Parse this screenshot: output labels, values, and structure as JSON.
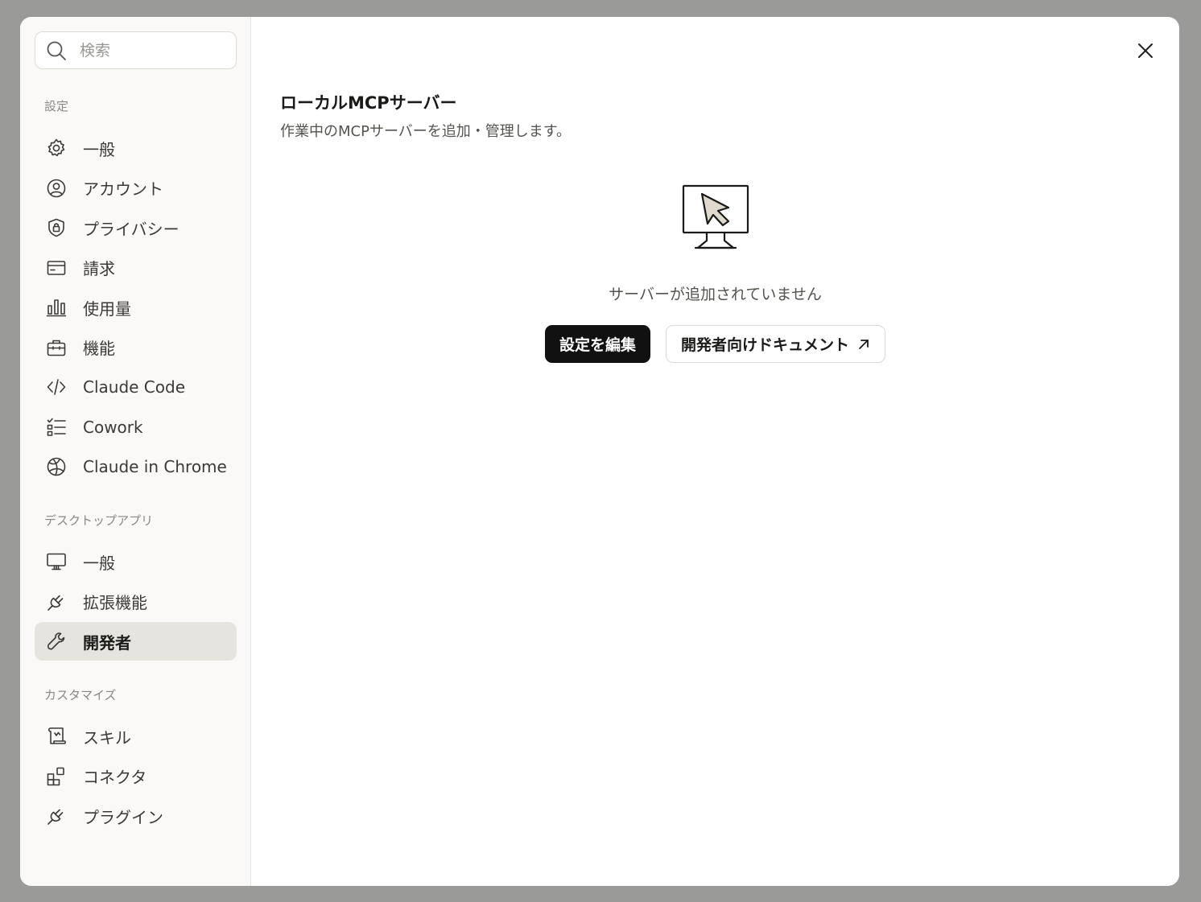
{
  "search": {
    "placeholder": "検索"
  },
  "sidebar": {
    "sections": [
      {
        "label": "設定",
        "items": [
          {
            "label": "一般",
            "icon": "gear-icon"
          },
          {
            "label": "アカウント",
            "icon": "user-circle-icon"
          },
          {
            "label": "プライバシー",
            "icon": "shield-lock-icon"
          },
          {
            "label": "請求",
            "icon": "credit-card-icon"
          },
          {
            "label": "使用量",
            "icon": "bar-chart-icon"
          },
          {
            "label": "機能",
            "icon": "briefcase-icon"
          },
          {
            "label": "Claude Code",
            "icon": "code-icon"
          },
          {
            "label": "Cowork",
            "icon": "checklist-icon"
          },
          {
            "label": "Claude in Chrome",
            "icon": "globe-icon"
          }
        ]
      },
      {
        "label": "デスクトップアプリ",
        "items": [
          {
            "label": "一般",
            "icon": "monitor-icon"
          },
          {
            "label": "拡張機能",
            "icon": "plug-icon"
          },
          {
            "label": "開発者",
            "icon": "wrench-icon",
            "active": true
          }
        ]
      },
      {
        "label": "カスタマイズ",
        "items": [
          {
            "label": "スキル",
            "icon": "scroll-icon"
          },
          {
            "label": "コネクタ",
            "icon": "blocks-icon"
          },
          {
            "label": "プラグイン",
            "icon": "plug-icon"
          }
        ]
      }
    ]
  },
  "main": {
    "title": "ローカルMCPサーバー",
    "subtitle": "作業中のMCPサーバーを追加・管理します。",
    "empty_text": "サーバーが追加されていません",
    "edit_button": "設定を編集",
    "docs_button": "開発者向けドキュメント"
  },
  "colors": {
    "primary_button": "#111111",
    "sidebar_bg": "#faf9f7",
    "active_item_bg": "#e6e4df",
    "overlay": "#9a9a99"
  }
}
